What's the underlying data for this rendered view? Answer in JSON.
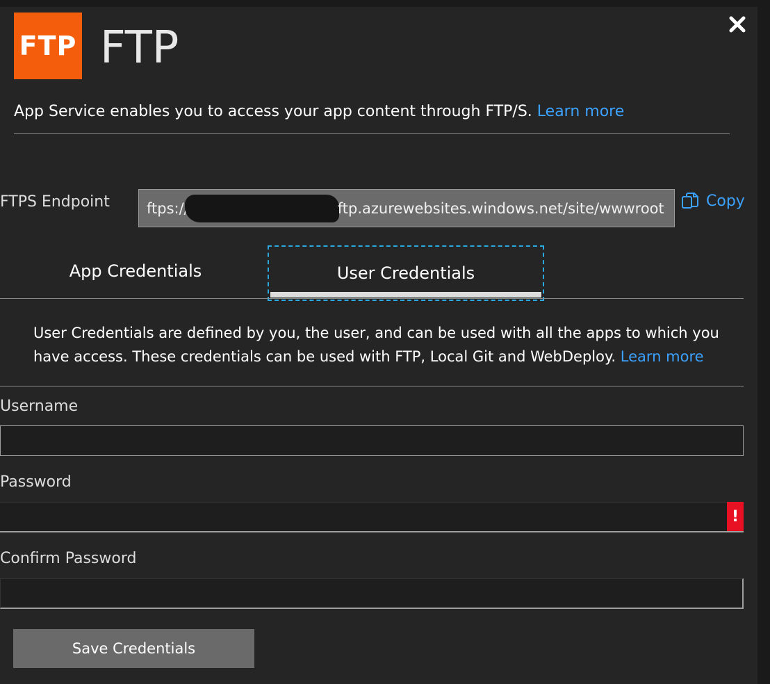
{
  "header": {
    "logo_text": "FTP",
    "title": "FTP"
  },
  "intro": {
    "text": "App Service enables you to access your app content through FTP/S.",
    "learn_more": "Learn more"
  },
  "endpoint": {
    "label": "FTPS Endpoint",
    "value_prefix": "ftps://",
    "value_suffix": "ftp.azurewebsites.windows.net/site/wwwroot",
    "copy_label": "Copy"
  },
  "tabs": [
    {
      "label": "App Credentials",
      "selected": false
    },
    {
      "label": "User Credentials",
      "selected": true
    }
  ],
  "user_credentials": {
    "description": "User Credentials are defined by you, the user, and can be used with all the apps to which you have access. These credentials can be used with FTP, Local Git and WebDeploy.",
    "learn_more": "Learn more"
  },
  "form": {
    "username_label": "Username",
    "username_value": "",
    "password_label": "Password",
    "password_value": "",
    "password_error_icon": "!",
    "confirm_label": "Confirm Password",
    "confirm_value": "",
    "save_label": "Save Credentials"
  },
  "colors": {
    "logo_bg": "#f35d0b",
    "link": "#3ca2ff",
    "error": "#e81123",
    "focus_outline": "#2aa8e0"
  },
  "icons": {
    "close": "close-icon",
    "copy": "copy-icon",
    "error": "error-icon"
  }
}
